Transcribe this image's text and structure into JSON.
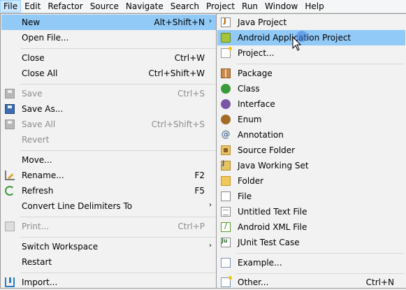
{
  "menubar": [
    "File",
    "Edit",
    "Refactor",
    "Source",
    "Navigate",
    "Search",
    "Project",
    "Run",
    "Window",
    "Help"
  ],
  "file_menu": {
    "new": {
      "label": "New",
      "accel": "Alt+Shift+N"
    },
    "open_file": {
      "label": "Open File..."
    },
    "close": {
      "label": "Close",
      "accel": "Ctrl+W"
    },
    "close_all": {
      "label": "Close All",
      "accel": "Ctrl+Shift+W"
    },
    "save": {
      "label": "Save",
      "accel": "Ctrl+S"
    },
    "save_as": {
      "label": "Save As..."
    },
    "save_all": {
      "label": "Save All",
      "accel": "Ctrl+Shift+S"
    },
    "revert": {
      "label": "Revert"
    },
    "move": {
      "label": "Move..."
    },
    "rename": {
      "label": "Rename...",
      "accel": "F2"
    },
    "refresh": {
      "label": "Refresh",
      "accel": "F5"
    },
    "convert": {
      "label": "Convert Line Delimiters To"
    },
    "print": {
      "label": "Print...",
      "accel": "Ctrl+P"
    },
    "switch_workspace": {
      "label": "Switch Workspace"
    },
    "restart": {
      "label": "Restart"
    },
    "import": {
      "label": "Import..."
    }
  },
  "new_submenu": {
    "java_project": "Java Project",
    "android_app_project": "Android Application Project",
    "project": "Project...",
    "package": "Package",
    "class": "Class",
    "interface": "Interface",
    "enum": "Enum",
    "annotation": "Annotation",
    "source_folder": "Source Folder",
    "java_working_set": "Java Working Set",
    "folder": "Folder",
    "file": "File",
    "untitled_text_file": "Untitled Text File",
    "android_xml_file": "Android XML File",
    "junit_test_case": "JUnit Test Case",
    "example": "Example...",
    "other": "Other...",
    "other_accel": "Ctrl+N"
  },
  "submenu_arrow": "›",
  "colors": {
    "highlight": "#91c9f7",
    "menu_bg": "#f2f2f2",
    "disabled_text": "#8d8d8d"
  }
}
